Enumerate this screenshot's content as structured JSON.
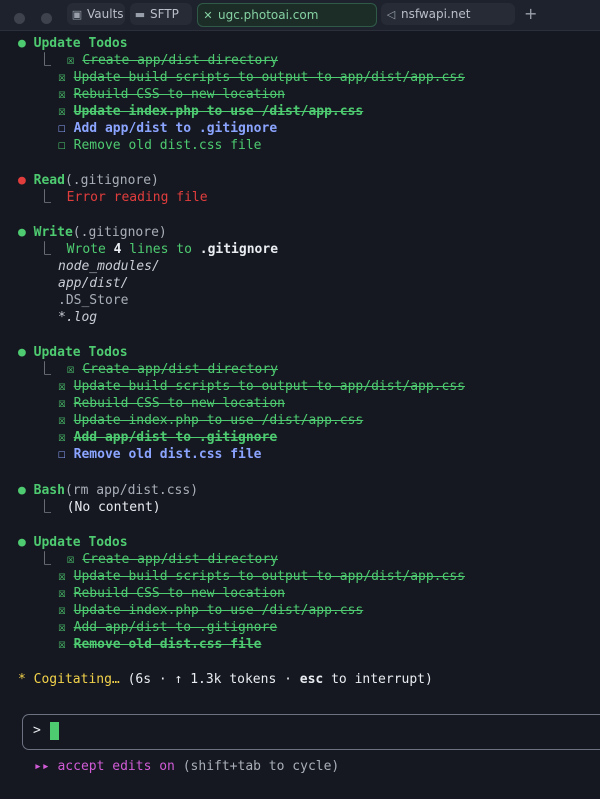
{
  "tabs": [
    {
      "icon": "vault-icon",
      "label": "Vaults"
    },
    {
      "icon": "folder-icon",
      "label": "SFTP"
    },
    {
      "icon": "close-icon",
      "label": "ugc.photoai.com"
    },
    {
      "icon": "arrow-icon",
      "label": "nsfwapi.net"
    }
  ],
  "new_tab_label": "+",
  "bullet": "●",
  "tree_branch": "⎿",
  "box_checked": "☒",
  "box_unchecked": "☐",
  "blocks": {
    "todos1": {
      "title": "Update Todos",
      "items": [
        "Create app/dist directory",
        "Update build scripts to output to app/dist/app.css",
        "Rebuild CSS to new location",
        "Update index.php to use /dist/app.css",
        "Add app/dist to .gitignore",
        "Remove old dist.css file"
      ]
    },
    "read": {
      "tool": "Read",
      "arg": "(.gitignore)",
      "result": "Error reading file"
    },
    "write": {
      "tool": "Write",
      "arg": "(.gitignore)",
      "result_prefix": "Wrote",
      "result_count": "4",
      "result_mid": "lines to",
      "result_file": ".gitignore",
      "lines": [
        "node_modules/",
        "app/dist/",
        ".DS_Store",
        "*.log"
      ]
    },
    "todos2": {
      "title": "Update Todos",
      "items": [
        "Create app/dist directory",
        "Update build scripts to output to app/dist/app.css",
        "Rebuild CSS to new location",
        "Update index.php to use /dist/app.css",
        "Add app/dist to .gitignore",
        "Remove old dist.css file"
      ]
    },
    "bash": {
      "tool": "Bash",
      "arg": "(rm app/dist.css)",
      "result": "(No content)"
    },
    "todos3": {
      "title": "Update Todos",
      "items": [
        "Create app/dist directory",
        "Update build scripts to output to app/dist/app.css",
        "Rebuild CSS to new location",
        "Update index.php to use /dist/app.css",
        "Add app/dist to .gitignore",
        "Remove old dist.css file"
      ]
    }
  },
  "status": {
    "spinner": "*",
    "label": "Cogitating…",
    "open": "(6s · ↑ 1.3k tokens ·",
    "key": "esc",
    "close": "to interrupt)"
  },
  "input": {
    "prompt": ">",
    "value": ""
  },
  "mode": {
    "arrows": "▸▸",
    "label": "accept edits on",
    "hint": "(shift+tab to cycle)"
  },
  "colors": {
    "background": "#151820",
    "green": "#4ecb71",
    "red": "#e23d3d",
    "in_progress": "#8ba4ff",
    "yellow": "#f2d24b",
    "magenta": "#d15bd7"
  }
}
